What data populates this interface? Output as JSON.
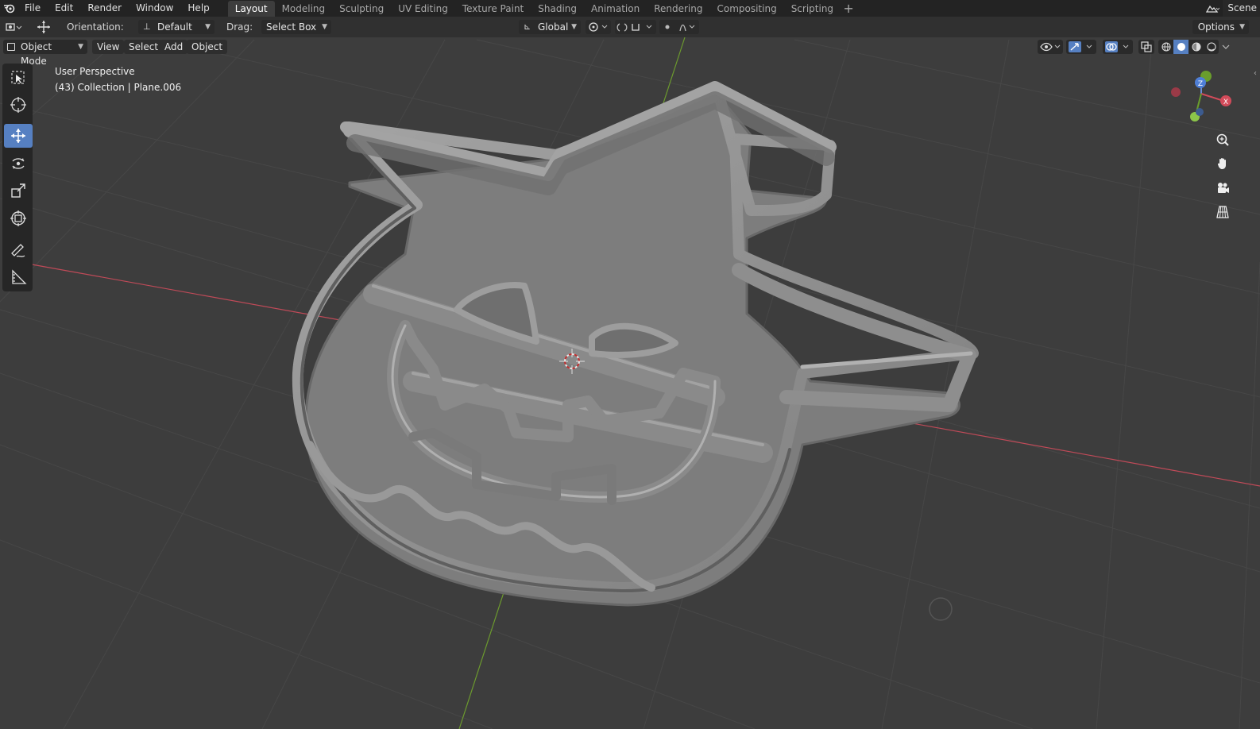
{
  "menubar": {
    "items": [
      "File",
      "Edit",
      "Render",
      "Window",
      "Help"
    ],
    "workspaces": [
      "Layout",
      "Modeling",
      "Sculpting",
      "UV Editing",
      "Texture Paint",
      "Shading",
      "Animation",
      "Rendering",
      "Compositing",
      "Scripting"
    ],
    "active_workspace": "Layout",
    "add_workspace": "+",
    "scene_label": "Scene"
  },
  "tool_header": {
    "orientation_label": "Orientation:",
    "orientation_value": "Default",
    "drag_label": "Drag:",
    "drag_value": "Select Box",
    "transform_orientation": "Global",
    "options_label": "Options"
  },
  "viewport_header": {
    "mode": "Object Mode",
    "menus": [
      "View",
      "Select",
      "Add",
      "Object"
    ]
  },
  "viewport": {
    "perspective_label": "User Perspective",
    "collection_label": "(43) Collection | Plane.006"
  },
  "toolbar": {
    "tools": [
      "select-box",
      "cursor",
      "move",
      "rotate",
      "scale",
      "transform",
      "annotate",
      "measure"
    ],
    "active_tool": "move"
  },
  "gizmo": {
    "axis_x": "X",
    "axis_y": "Y",
    "axis_z": "Z"
  },
  "colors": {
    "x_axis": "#c04a58",
    "y_axis": "#6c9a2e",
    "accent": "#5680c2",
    "model": "#8a8a8a"
  }
}
